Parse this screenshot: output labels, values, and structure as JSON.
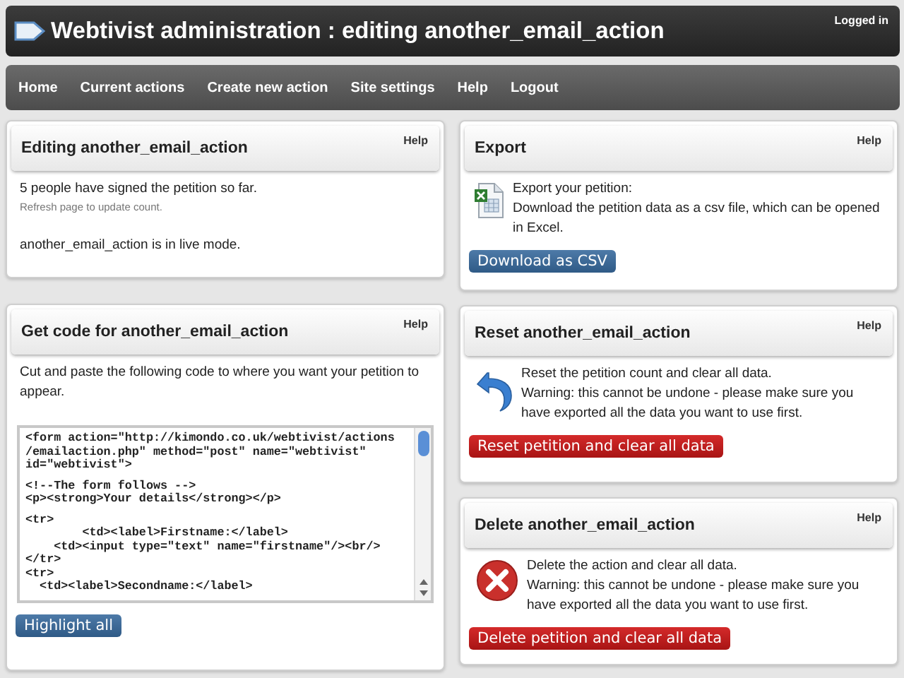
{
  "header": {
    "title": "Webtivist administration : editing another_email_action",
    "status": "Logged in"
  },
  "nav": {
    "items": [
      "Home",
      "Current actions",
      "Create new action",
      "Site settings",
      "Help",
      "Logout"
    ]
  },
  "columns": [
    {
      "panels": [
        {
          "kind": "status",
          "title": "Editing another_email_action",
          "help": "Help",
          "paragraphs": [
            {
              "kind": "text",
              "text": "5 people have signed the petition so far."
            },
            {
              "kind": "note",
              "text": "Refresh page to update count."
            },
            {
              "kind": "text",
              "text": "another_email_action is in live mode."
            }
          ]
        },
        {
          "kind": "code",
          "title": "Get code for another_email_action",
          "help": "Help",
          "paragraphs": [
            {
              "kind": "text",
              "text": "Cut and paste the following code to where you want your petition to appear."
            }
          ],
          "code_blocks": [
            [
              "<form action=\"http://kimondo.co.uk/webtivist/actions",
              "/emailaction.php\" method=\"post\" name=\"webtivist\"",
              "id=\"webtivist\">"
            ],
            [
              "<!--The form follows -->",
              "<p><strong>Your details</strong></p>"
            ],
            [
              "<tr>",
              "        <td><label>Firstname:</label>",
              "    <td><input type=\"text\" name=\"firstname\"/><br/>",
              "</tr>",
              "<tr>",
              "  <td><label>Secondname:</label>"
            ]
          ],
          "button": {
            "kind": "primary",
            "label": "Highlight all"
          }
        }
      ]
    },
    {
      "panels": [
        {
          "kind": "export",
          "title": "Export",
          "help": "Help",
          "paragraphs": [
            {
              "kind": "text",
              "text": "Export your petition:"
            },
            {
              "kind": "text",
              "text": "Download the petition data as a csv file, which can be opened in Excel."
            }
          ],
          "button": {
            "kind": "primary",
            "label": "Download as CSV"
          }
        },
        {
          "kind": "reset",
          "title": "Reset another_email_action",
          "help": "Help",
          "paragraphs": [
            {
              "kind": "text",
              "text": "Reset the petition count and clear all data."
            },
            {
              "kind": "text",
              "text": "Warning: this cannot be undone - please make sure you have exported all the data you want to use first."
            }
          ],
          "button": {
            "kind": "danger",
            "label": "Reset petition and clear all data"
          }
        },
        {
          "kind": "delete",
          "title": "Delete another_email_action",
          "help": "Help",
          "paragraphs": [
            {
              "kind": "text",
              "text": "Delete the action and clear all data."
            },
            {
              "kind": "text",
              "text": "Warning: this cannot be undone - please make sure you have exported all the data you want to use first."
            }
          ],
          "button": {
            "kind": "danger",
            "label": "Delete petition and clear all data"
          }
        }
      ]
    }
  ]
}
